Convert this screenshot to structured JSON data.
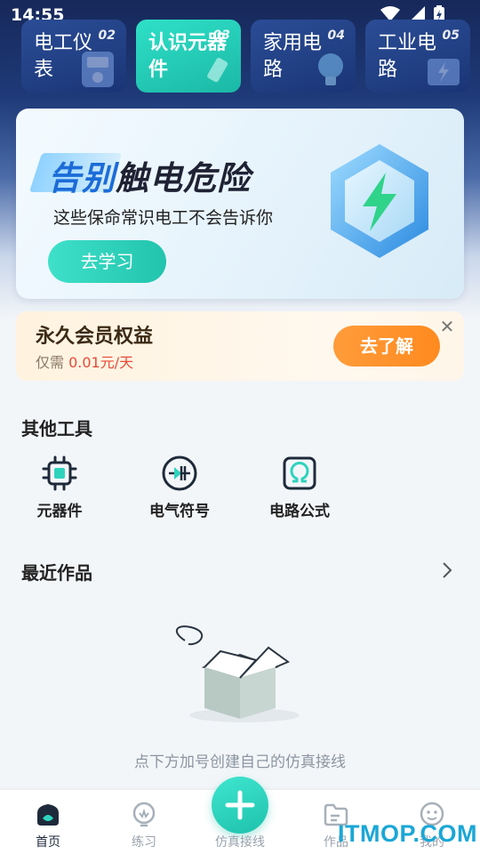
{
  "status_bar": {
    "time": "14:55"
  },
  "categories": [
    {
      "title": "电工仪表",
      "num": "02"
    },
    {
      "title": "认识元器件",
      "num": "03"
    },
    {
      "title": "家用电路",
      "num": "04"
    },
    {
      "title": "工业电路",
      "num": "05"
    }
  ],
  "banner": {
    "title_highlight": "告别",
    "title_rest": "触电危险",
    "subtitle": "这些保命常识电工不会告诉你",
    "button": "去学习"
  },
  "membership": {
    "title": "永久会员权益",
    "price_prefix": "仅需 ",
    "price": "0.01元/天",
    "button": "去了解",
    "close": "✕"
  },
  "other_tools": {
    "title": "其他工具",
    "items": [
      {
        "label": "元器件",
        "icon": "chip-icon"
      },
      {
        "label": "电气符号",
        "icon": "diode-symbol-icon"
      },
      {
        "label": "电路公式",
        "icon": "omega-icon"
      }
    ]
  },
  "recent_works": {
    "title": "最近作品",
    "empty_text": "点下方加号创建自己的仿真接线"
  },
  "tab_bar": {
    "items": [
      {
        "label": "首页",
        "icon": "home-icon"
      },
      {
        "label": "练习",
        "icon": "bulb-icon"
      },
      {
        "label": "仿真接线",
        "icon": "plus-icon"
      },
      {
        "label": "作品",
        "icon": "folder-icon"
      },
      {
        "label": "我的",
        "icon": "smiley-icon"
      }
    ],
    "active": "首页"
  },
  "watermark": "ITMOP.COM",
  "colors": {
    "accent_teal": "#22c4ad",
    "accent_orange": "#ff8a1f",
    "price_red": "#e84a36",
    "banner_blue": "#1c6cd8"
  }
}
